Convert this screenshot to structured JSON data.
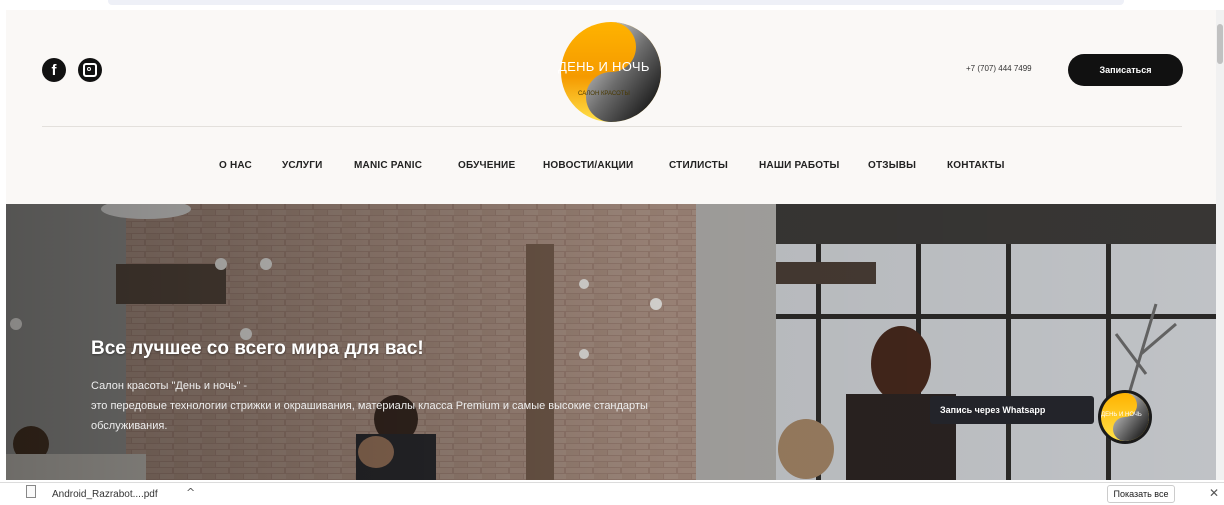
{
  "header": {
    "logo_title": "ДЕНЬ И НОЧЬ",
    "logo_subtitle": "САЛОН КРАСОТЫ",
    "phone": "+7 (707) 444 7499",
    "book_button": "Записаться"
  },
  "nav": {
    "items": [
      "О НАС",
      "УСЛУГИ",
      "MANIC PANIC",
      "ОБУЧЕНИЕ",
      "НОВОСТИ/АКЦИИ",
      "СТИЛИСТЫ",
      "НАШИ РАБОТЫ",
      "ОТЗЫВЫ",
      "КОНТАКТЫ"
    ]
  },
  "hero": {
    "title": "Все лучшее со всего мира для вас!",
    "line1": "Салон красоты \"День и ночь\" -",
    "line2": "это передовые технологии стрижки и окрашивания, материалы класса Premium и самые высокие стандарты",
    "line3": "обслуживания."
  },
  "whatsapp": {
    "label": "Запись через Whatsapp",
    "logo_text": "ДЕНЬ И НОЧЬ"
  },
  "download_bar": {
    "file_name": "Android_Razrabot....pdf",
    "show_all": "Показать все"
  },
  "icons": [
    "facebook-icon",
    "instagram-icon",
    "pdf-file-icon",
    "chevron-up-icon",
    "close-icon"
  ]
}
